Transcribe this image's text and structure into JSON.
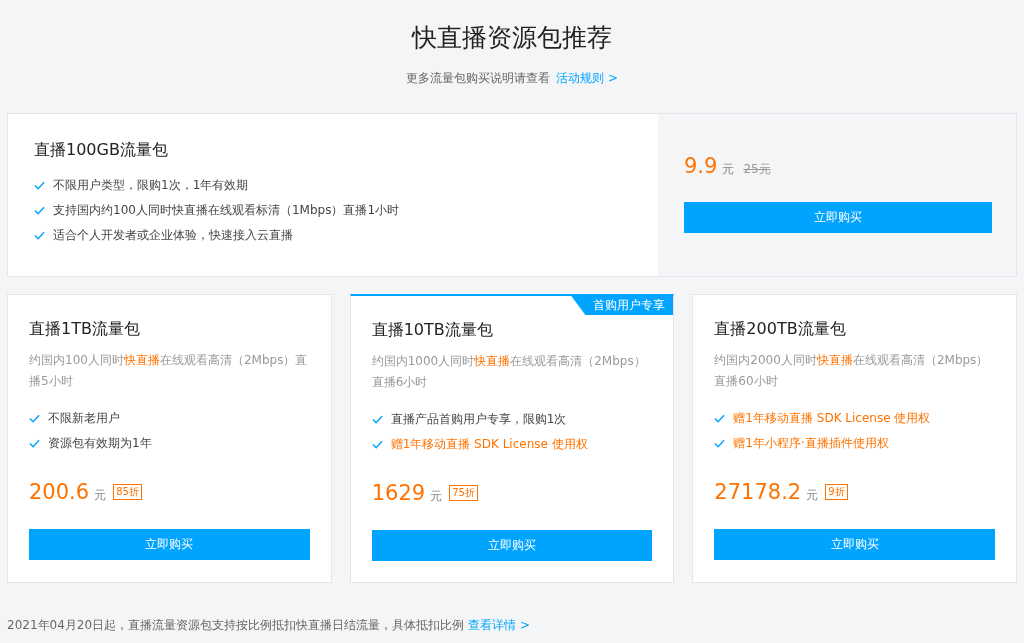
{
  "header": {
    "title": "快直播资源包推荐",
    "subtitle": "更多流量包购买说明请查看",
    "link": "活动规则 >"
  },
  "featured_package": {
    "name": "直播100GB流量包",
    "features": [
      "不限用户类型，限购1次，1年有效期",
      "支持国内约100人同时快直播在线观看标清（1Mbps）直播1小时",
      "适合个人开发者或企业体验，快速接入云直播"
    ],
    "price": "9.9",
    "unit": "元",
    "original_price": "25元",
    "button": "立即购买"
  },
  "packages": [
    {
      "name": "直播1TB流量包",
      "description": [
        {
          "text": "约国内100人同时",
          "highlight": false
        },
        {
          "text": "快直播",
          "highlight": true
        },
        {
          "text": "在线观看高清（2Mbps）直播5小时",
          "highlight": false
        }
      ],
      "features": [
        {
          "text": "不限新老用户",
          "highlight": false
        },
        {
          "text": "资源包有效期为1年",
          "highlight": false
        }
      ],
      "price": "200.6",
      "unit": "元",
      "discount": "85折",
      "button": "立即购买"
    },
    {
      "name": "直播10TB流量包",
      "badge": "首购用户专享",
      "description": [
        {
          "text": "约国内1000人同时",
          "highlight": false
        },
        {
          "text": "快直播",
          "highlight": true
        },
        {
          "text": "在线观看高清（2Mbps）直播6小时",
          "highlight": false
        }
      ],
      "features": [
        {
          "text": "直播产品首购用户专享，限购1次",
          "highlight": false
        },
        {
          "text": "赠1年移动直播 SDK License 使用权",
          "highlight": true
        }
      ],
      "price": "1629",
      "unit": "元",
      "discount": "75折",
      "button": "立即购买"
    },
    {
      "name": "直播200TB流量包",
      "description": [
        {
          "text": "约国内2000人同时",
          "highlight": false
        },
        {
          "text": "快直播",
          "highlight": true
        },
        {
          "text": "在线观看高清（2Mbps）直播60小时",
          "highlight": false
        }
      ],
      "features": [
        {
          "text": "赠1年移动直播 SDK License 使用权",
          "highlight": true
        },
        {
          "text": "赠1年小程序·直播插件使用权",
          "highlight": true
        }
      ],
      "price": "27178.2",
      "unit": "元",
      "discount": "9折",
      "button": "立即购买"
    }
  ],
  "footer": {
    "text": "2021年04月20日起，直播流量资源包支持按比例抵扣快直播日结流量，具体抵扣比例",
    "link": "查看详情 >"
  }
}
